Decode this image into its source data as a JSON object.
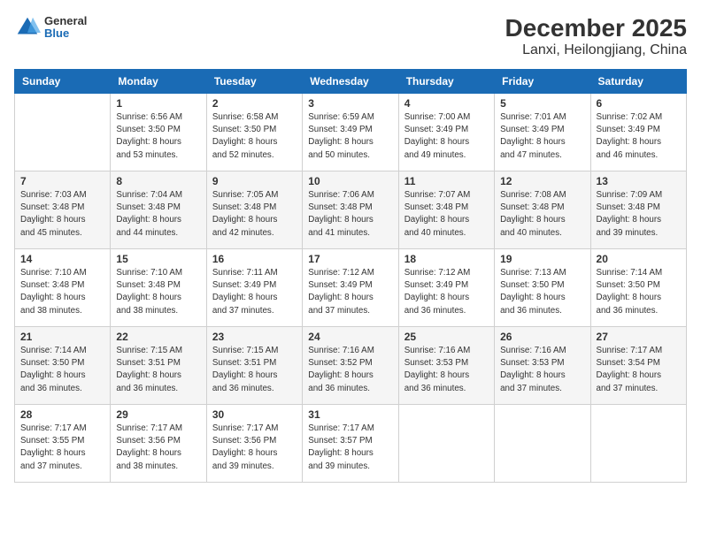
{
  "header": {
    "logo": {
      "general": "General",
      "blue": "Blue"
    },
    "title": "December 2025",
    "subtitle": "Lanxi, Heilongjiang, China"
  },
  "days_of_week": [
    "Sunday",
    "Monday",
    "Tuesday",
    "Wednesday",
    "Thursday",
    "Friday",
    "Saturday"
  ],
  "weeks": [
    [
      {
        "day": "",
        "info": ""
      },
      {
        "day": "1",
        "info": "Sunrise: 6:56 AM\nSunset: 3:50 PM\nDaylight: 8 hours\nand 53 minutes."
      },
      {
        "day": "2",
        "info": "Sunrise: 6:58 AM\nSunset: 3:50 PM\nDaylight: 8 hours\nand 52 minutes."
      },
      {
        "day": "3",
        "info": "Sunrise: 6:59 AM\nSunset: 3:49 PM\nDaylight: 8 hours\nand 50 minutes."
      },
      {
        "day": "4",
        "info": "Sunrise: 7:00 AM\nSunset: 3:49 PM\nDaylight: 8 hours\nand 49 minutes."
      },
      {
        "day": "5",
        "info": "Sunrise: 7:01 AM\nSunset: 3:49 PM\nDaylight: 8 hours\nand 47 minutes."
      },
      {
        "day": "6",
        "info": "Sunrise: 7:02 AM\nSunset: 3:49 PM\nDaylight: 8 hours\nand 46 minutes."
      }
    ],
    [
      {
        "day": "7",
        "info": "Sunrise: 7:03 AM\nSunset: 3:48 PM\nDaylight: 8 hours\nand 45 minutes."
      },
      {
        "day": "8",
        "info": "Sunrise: 7:04 AM\nSunset: 3:48 PM\nDaylight: 8 hours\nand 44 minutes."
      },
      {
        "day": "9",
        "info": "Sunrise: 7:05 AM\nSunset: 3:48 PM\nDaylight: 8 hours\nand 42 minutes."
      },
      {
        "day": "10",
        "info": "Sunrise: 7:06 AM\nSunset: 3:48 PM\nDaylight: 8 hours\nand 41 minutes."
      },
      {
        "day": "11",
        "info": "Sunrise: 7:07 AM\nSunset: 3:48 PM\nDaylight: 8 hours\nand 40 minutes."
      },
      {
        "day": "12",
        "info": "Sunrise: 7:08 AM\nSunset: 3:48 PM\nDaylight: 8 hours\nand 40 minutes."
      },
      {
        "day": "13",
        "info": "Sunrise: 7:09 AM\nSunset: 3:48 PM\nDaylight: 8 hours\nand 39 minutes."
      }
    ],
    [
      {
        "day": "14",
        "info": "Sunrise: 7:10 AM\nSunset: 3:48 PM\nDaylight: 8 hours\nand 38 minutes."
      },
      {
        "day": "15",
        "info": "Sunrise: 7:10 AM\nSunset: 3:48 PM\nDaylight: 8 hours\nand 38 minutes."
      },
      {
        "day": "16",
        "info": "Sunrise: 7:11 AM\nSunset: 3:49 PM\nDaylight: 8 hours\nand 37 minutes."
      },
      {
        "day": "17",
        "info": "Sunrise: 7:12 AM\nSunset: 3:49 PM\nDaylight: 8 hours\nand 37 minutes."
      },
      {
        "day": "18",
        "info": "Sunrise: 7:12 AM\nSunset: 3:49 PM\nDaylight: 8 hours\nand 36 minutes."
      },
      {
        "day": "19",
        "info": "Sunrise: 7:13 AM\nSunset: 3:50 PM\nDaylight: 8 hours\nand 36 minutes."
      },
      {
        "day": "20",
        "info": "Sunrise: 7:14 AM\nSunset: 3:50 PM\nDaylight: 8 hours\nand 36 minutes."
      }
    ],
    [
      {
        "day": "21",
        "info": "Sunrise: 7:14 AM\nSunset: 3:50 PM\nDaylight: 8 hours\nand 36 minutes."
      },
      {
        "day": "22",
        "info": "Sunrise: 7:15 AM\nSunset: 3:51 PM\nDaylight: 8 hours\nand 36 minutes."
      },
      {
        "day": "23",
        "info": "Sunrise: 7:15 AM\nSunset: 3:51 PM\nDaylight: 8 hours\nand 36 minutes."
      },
      {
        "day": "24",
        "info": "Sunrise: 7:16 AM\nSunset: 3:52 PM\nDaylight: 8 hours\nand 36 minutes."
      },
      {
        "day": "25",
        "info": "Sunrise: 7:16 AM\nSunset: 3:53 PM\nDaylight: 8 hours\nand 36 minutes."
      },
      {
        "day": "26",
        "info": "Sunrise: 7:16 AM\nSunset: 3:53 PM\nDaylight: 8 hours\nand 37 minutes."
      },
      {
        "day": "27",
        "info": "Sunrise: 7:17 AM\nSunset: 3:54 PM\nDaylight: 8 hours\nand 37 minutes."
      }
    ],
    [
      {
        "day": "28",
        "info": "Sunrise: 7:17 AM\nSunset: 3:55 PM\nDaylight: 8 hours\nand 37 minutes."
      },
      {
        "day": "29",
        "info": "Sunrise: 7:17 AM\nSunset: 3:56 PM\nDaylight: 8 hours\nand 38 minutes."
      },
      {
        "day": "30",
        "info": "Sunrise: 7:17 AM\nSunset: 3:56 PM\nDaylight: 8 hours\nand 39 minutes."
      },
      {
        "day": "31",
        "info": "Sunrise: 7:17 AM\nSunset: 3:57 PM\nDaylight: 8 hours\nand 39 minutes."
      },
      {
        "day": "",
        "info": ""
      },
      {
        "day": "",
        "info": ""
      },
      {
        "day": "",
        "info": ""
      }
    ]
  ]
}
